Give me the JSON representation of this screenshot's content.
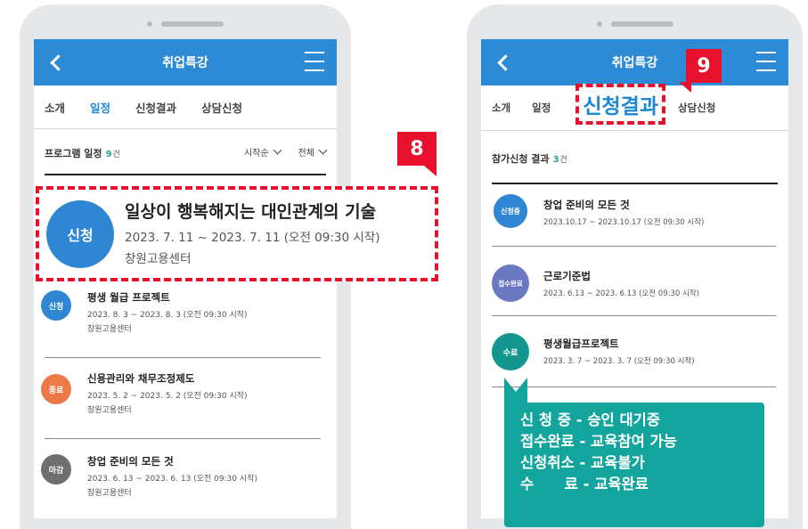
{
  "left": {
    "appbar": {
      "title": "취업특강"
    },
    "tabs": [
      {
        "label": "소개"
      },
      {
        "label": "일정"
      },
      {
        "label": "신청결과"
      },
      {
        "label": "상담신청"
      }
    ],
    "list_header": {
      "title": "프로그램 일정",
      "count": "9",
      "unit": "건",
      "sort1": "시작순",
      "sort2": "전체"
    },
    "highlight": {
      "badge": "8",
      "status": "신청",
      "title": "일상이 행복해지는 대인관계의 기술",
      "date": "2023. 7. 11 ~ 2023. 7. 11 (오전 09:30 시작)",
      "place": "창원고용센터"
    },
    "items": [
      {
        "status": "신청",
        "color": "#2f86d2",
        "title": "평생 월급 프로젝트",
        "date": "2023. 8. 3 ~ 2023. 8. 3 (오전 09:30 시작)",
        "place": "창원고용센터"
      },
      {
        "status": "종료",
        "color": "#ec7a47",
        "title": "신용관리와 채무조정제도",
        "date": "2023. 5. 2 ~ 2023. 5. 2 (오전 09:30 시작)",
        "place": "창원고용센터"
      },
      {
        "status": "마감",
        "color": "#6f6f6f",
        "title": "창업 준비의 모든 것",
        "date": "2023. 6. 13 ~ 2023. 6. 13 (오전 09:30 시작)",
        "place": "창원고용센터"
      }
    ]
  },
  "right": {
    "appbar": {
      "title": "취업특강"
    },
    "badge": "9",
    "tabs": [
      {
        "label": "소개"
      },
      {
        "label": "일정"
      },
      {
        "label": "신청결과"
      },
      {
        "label": "상담신청"
      }
    ],
    "list_header": {
      "title": "참가신청 결과",
      "count": "3",
      "unit": "건"
    },
    "items": [
      {
        "status": "신청중",
        "color": "#2f86d2",
        "title": "창업 준비의 모든 것",
        "date": "2023.10.17 ~ 2023.10.17 (오전 09:30 시작)"
      },
      {
        "status": "접수완료",
        "color": "#6b78c2",
        "title": "근로기준법",
        "date": "2023. 6.13 ~ 2023. 6.13 (오전 09:30 시작)"
      },
      {
        "status": "수료",
        "color": "#13968e",
        "title": "평생월급프로젝트",
        "date": "2023. 3. 7 ~ 2023. 3. 7 (오전 09:30 시작)"
      }
    ],
    "legend": [
      "신 청 중 - 승인 대기중",
      "접수완료 - 교육참여 가능",
      "신청취소 - 교육불가",
      "수      료 - 교육완료"
    ]
  },
  "colors": {
    "primary": "#2d8ad5",
    "accent_red": "#e8112d",
    "teal": "#13a59d"
  }
}
